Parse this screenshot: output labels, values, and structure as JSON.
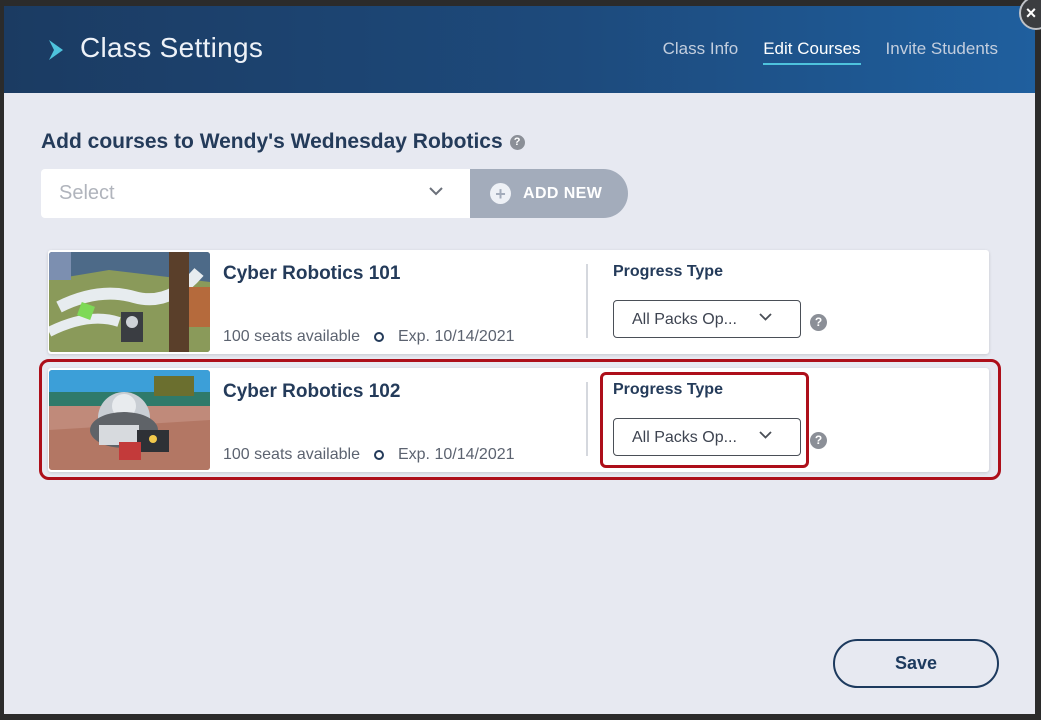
{
  "header": {
    "title": "Class Settings",
    "tabs": [
      {
        "label": "Class Info",
        "active": false
      },
      {
        "label": "Edit Courses",
        "active": true
      },
      {
        "label": "Invite Students",
        "active": false
      }
    ]
  },
  "add_courses": {
    "heading": "Add courses to Wendy's Wednesday Robotics",
    "select_placeholder": "Select",
    "add_new_label": "ADD NEW"
  },
  "courses": [
    {
      "title": "Cyber Robotics 101",
      "seats": "100 seats available",
      "expiration": "Exp. 10/14/2021",
      "progress_label": "Progress Type",
      "progress_value": "All Packs Op..."
    },
    {
      "title": "Cyber Robotics 102",
      "seats": "100 seats available",
      "expiration": "Exp. 10/14/2021",
      "progress_label": "Progress Type",
      "progress_value": "All Packs Op..."
    }
  ],
  "footer": {
    "save_label": "Save"
  },
  "close_label": "×",
  "help_glyph": "?",
  "colors": {
    "accent": "#4ec3dd",
    "navy": "#243b5a",
    "highlight": "#ad0f1a",
    "add_new_bg": "#a3acbb"
  }
}
